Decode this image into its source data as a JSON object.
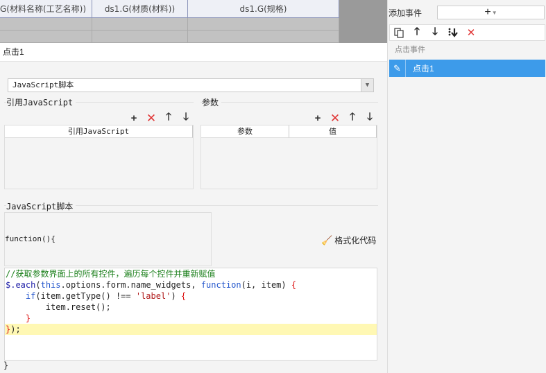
{
  "sheet": {
    "headers": [
      "G(材料名称(工艺名称))",
      "ds1.G(材质(材料))",
      "ds1.G(规格)"
    ]
  },
  "right_panel": {
    "add_event_label": "添加事件",
    "add_button_label": "+",
    "section_label": "点击事件",
    "events": [
      {
        "label": "点击1"
      }
    ]
  },
  "dialog": {
    "title": "点击1",
    "type_select": {
      "value": "JavaScript脚本"
    },
    "ref_js": {
      "title": "引用JavaScript",
      "column": "引用JavaScript"
    },
    "params": {
      "title": "参数",
      "columns": [
        "参数",
        "值"
      ]
    },
    "script": {
      "title": "JavaScript脚本",
      "open_line": "function(){",
      "format_button": "格式化代码",
      "close_line": "}"
    }
  },
  "code_lines": [
    "//获取参数界面上的所有控件，遍历每个控件并重新赋值",
    "$.each(this.options.form.name_widgets, function(i, item) {",
    "    if(item.getType() !== 'label') {",
    "        item.reset();",
    "    }",
    "});",
    "",
    "",
    ""
  ],
  "icons": {
    "add": "plus-icon",
    "delete": "delete-x-icon",
    "up": "arrow-up-icon",
    "down": "arrow-down-icon",
    "copy": "copy-icon",
    "move_bottom": "move-to-bottom-icon",
    "edit": "pencil-icon",
    "format": "broom-icon"
  },
  "colors": {
    "selected_event": "#3d9bea",
    "delete_red": "#e03434",
    "highlight_line": "#fff8b4"
  }
}
